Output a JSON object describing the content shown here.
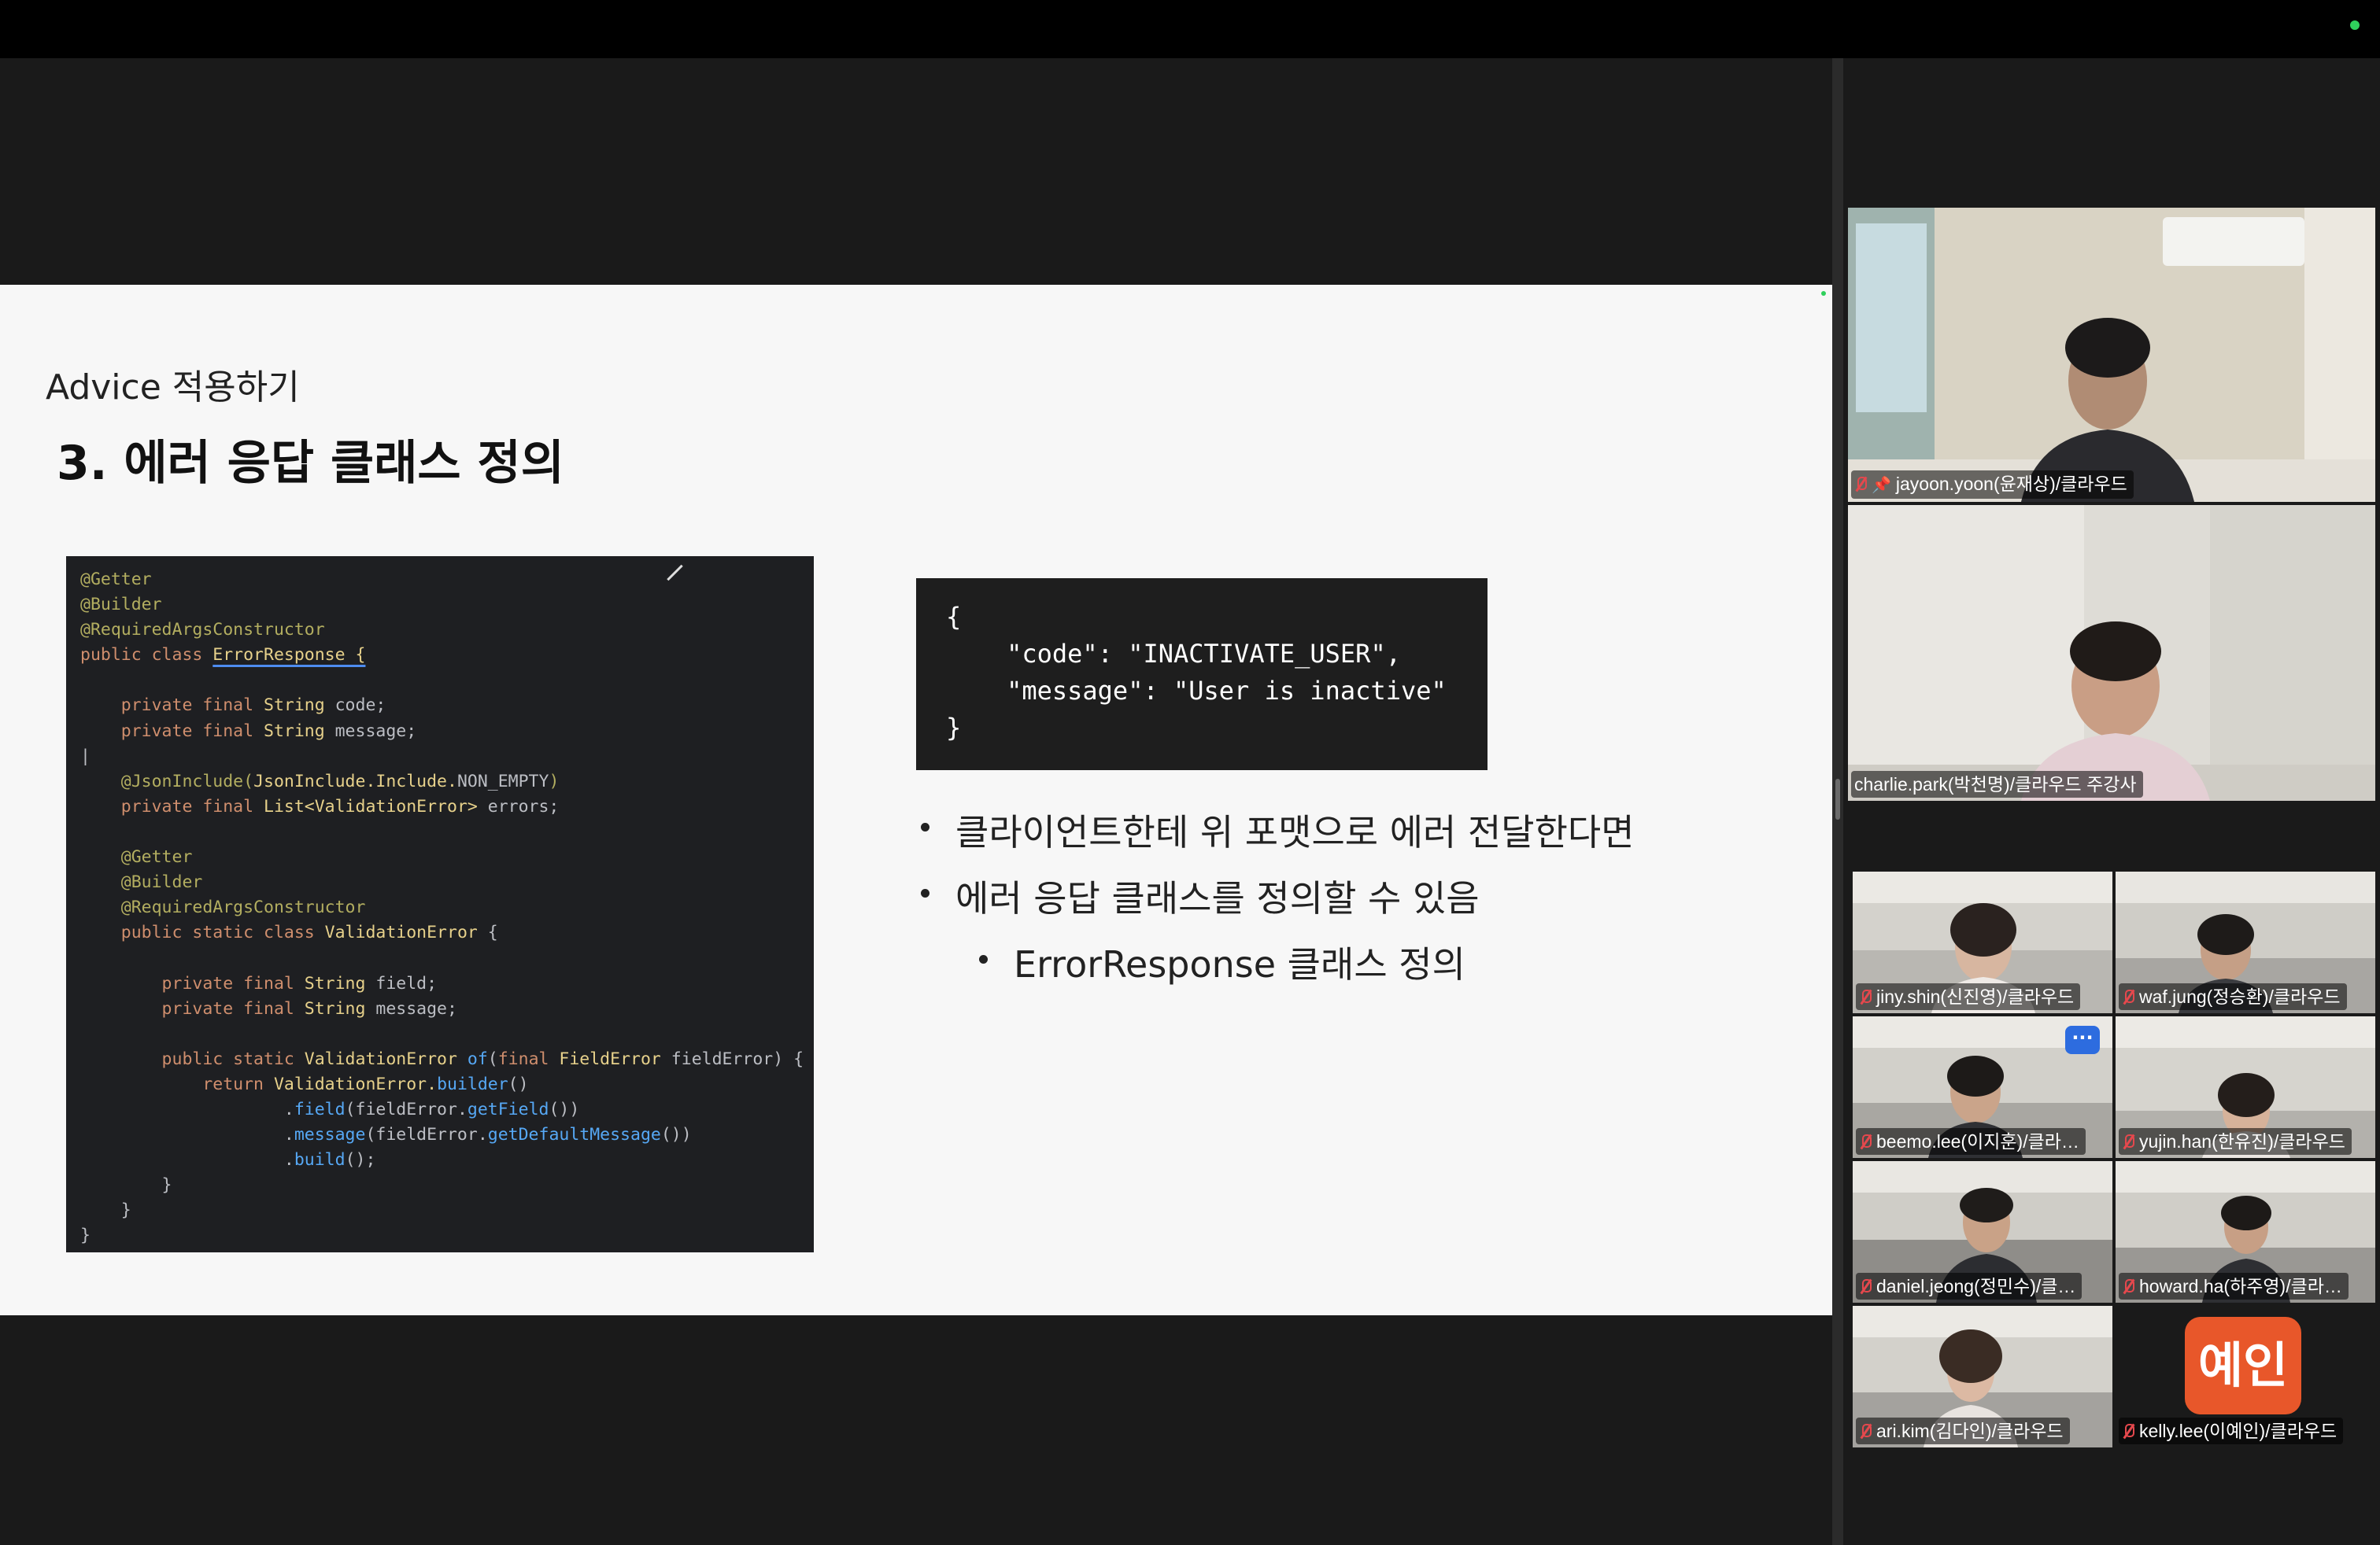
{
  "slide": {
    "kicker": "Advice 적용하기",
    "title": "3. 에러 응답 클래스 정의",
    "java_code": [
      [
        {
          "t": "@Getter",
          "c": "an"
        }
      ],
      [
        {
          "t": "@Builder",
          "c": "an"
        }
      ],
      [
        {
          "t": "@RequiredArgsConstructor",
          "c": "an"
        }
      ],
      [
        {
          "t": "public class ",
          "c": "kw"
        },
        {
          "t": "ErrorResponse {",
          "c": "cl",
          "u": true
        }
      ],
      [],
      [
        {
          "t": "    private final ",
          "c": "kw"
        },
        {
          "t": "String",
          "c": "cl"
        },
        {
          "t": " code;",
          "c": "ty"
        }
      ],
      [
        {
          "t": "    private final ",
          "c": "kw"
        },
        {
          "t": "String",
          "c": "cl"
        },
        {
          "t": " message;",
          "c": "ty"
        }
      ],
      [
        {
          "t": "|",
          "c": "ty"
        }
      ],
      [
        {
          "t": "    @JsonInclude(",
          "c": "an"
        },
        {
          "t": "JsonInclude.Include.",
          "c": "cl"
        },
        {
          "t": "NON_EMPTY",
          "c": "ty"
        },
        {
          "t": ")",
          "c": "an"
        }
      ],
      [
        {
          "t": "    private final ",
          "c": "kw"
        },
        {
          "t": "List<ValidationError>",
          "c": "cl"
        },
        {
          "t": " errors;",
          "c": "ty"
        }
      ],
      [],
      [
        {
          "t": "    @Getter",
          "c": "an"
        }
      ],
      [
        {
          "t": "    @Builder",
          "c": "an"
        }
      ],
      [
        {
          "t": "    @RequiredArgsConstructor",
          "c": "an"
        }
      ],
      [
        {
          "t": "    public static class ",
          "c": "kw"
        },
        {
          "t": "ValidationError",
          "c": "cl"
        },
        {
          "t": " {",
          "c": "ty"
        }
      ],
      [],
      [
        {
          "t": "        private final ",
          "c": "kw"
        },
        {
          "t": "String",
          "c": "cl"
        },
        {
          "t": " field;",
          "c": "ty"
        }
      ],
      [
        {
          "t": "        private final ",
          "c": "kw"
        },
        {
          "t": "String",
          "c": "cl"
        },
        {
          "t": " message;",
          "c": "ty"
        }
      ],
      [],
      [
        {
          "t": "        public static ",
          "c": "kw"
        },
        {
          "t": "ValidationError ",
          "c": "cl"
        },
        {
          "t": "of",
          "c": "fn"
        },
        {
          "t": "(",
          "c": "ty"
        },
        {
          "t": "final ",
          "c": "kw"
        },
        {
          "t": "FieldError",
          "c": "cl"
        },
        {
          "t": " fieldError) {",
          "c": "ty"
        }
      ],
      [
        {
          "t": "            return ",
          "c": "kw"
        },
        {
          "t": "ValidationError.",
          "c": "cl"
        },
        {
          "t": "builder",
          "c": "fn"
        },
        {
          "t": "()",
          "c": "ty"
        }
      ],
      [
        {
          "t": "                    .",
          "c": "ty"
        },
        {
          "t": "field",
          "c": "fn"
        },
        {
          "t": "(fieldError.",
          "c": "ty"
        },
        {
          "t": "getField",
          "c": "fn"
        },
        {
          "t": "())",
          "c": "ty"
        }
      ],
      [
        {
          "t": "                    .",
          "c": "ty"
        },
        {
          "t": "message",
          "c": "fn"
        },
        {
          "t": "(fieldError.",
          "c": "ty"
        },
        {
          "t": "getDefaultMessage",
          "c": "fn"
        },
        {
          "t": "())",
          "c": "ty"
        }
      ],
      [
        {
          "t": "                    .",
          "c": "ty"
        },
        {
          "t": "build",
          "c": "fn"
        },
        {
          "t": "();",
          "c": "ty"
        }
      ],
      [
        {
          "t": "        }",
          "c": "ty"
        }
      ],
      [
        {
          "t": "    }",
          "c": "ty"
        }
      ],
      [
        {
          "t": "}",
          "c": "ty"
        }
      ]
    ],
    "json_code": "{\n    \"code\": \"INACTIVATE_USER\",\n    \"message\": \"User is inactive\"\n}",
    "bullets": [
      {
        "text": "클라이언트한테 위 포맷으로 에러 전달한다면",
        "level": 1
      },
      {
        "text": "에러 응답 클래스를 정의할 수 있음",
        "level": 1
      },
      {
        "text": "ErrorResponse 클래스 정의",
        "level": 2
      }
    ]
  },
  "participants": {
    "featured": [
      {
        "name": "jayoon.yoon(윤재상)/클라우드",
        "pinned": true,
        "muted": true,
        "active": false
      },
      {
        "name": "charlie.park(박천명)/클라우드 주강사",
        "pinned": false,
        "muted": false,
        "active": true
      }
    ],
    "grid": [
      {
        "name": "jiny.shin(신진영)/클라우드",
        "muted": true
      },
      {
        "name": "waf.jung(정승환)/클라우드",
        "muted": true
      },
      {
        "name": "beemo.lee(이지훈)/클라…",
        "muted": true,
        "more_label": "···"
      },
      {
        "name": "yujin.han(한유진)/클라우드",
        "muted": true
      },
      {
        "name": "daniel.jeong(정민수)/클…",
        "muted": true
      },
      {
        "name": "howard.ha(하주영)/클라…",
        "muted": true
      },
      {
        "name": "ari.kim(김다인)/클라우드",
        "muted": true
      },
      {
        "name": "kelly.lee(이예인)/클라우드",
        "muted": true,
        "avatar": "예인"
      }
    ]
  },
  "colors": {
    "active_speaker": "#31c957",
    "muted_mic": "#e5484d",
    "avatar_bg": "#e8572a"
  }
}
